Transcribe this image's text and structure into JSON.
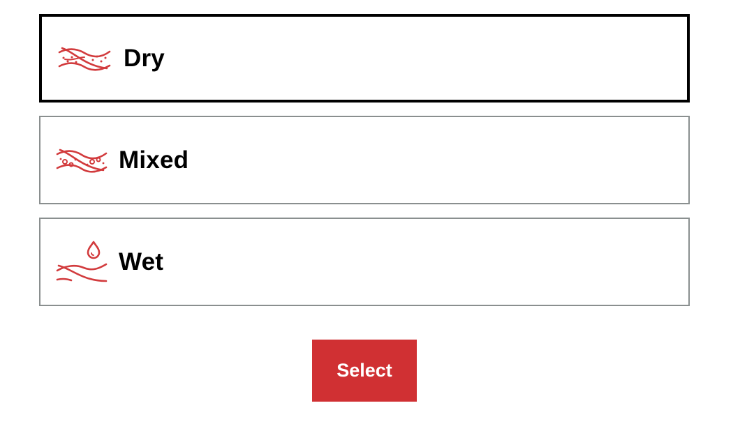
{
  "options": [
    {
      "label": "Dry",
      "icon": "dry-skin-icon",
      "selected": true
    },
    {
      "label": "Mixed",
      "icon": "mixed-skin-icon",
      "selected": false
    },
    {
      "label": "Wet",
      "icon": "wet-skin-icon",
      "selected": false
    }
  ],
  "select_button": {
    "label": "Select"
  },
  "colors": {
    "accent": "#d03033",
    "selected_border": "#000000",
    "default_border": "#8a8f8f",
    "icon": "#d23b3d"
  }
}
